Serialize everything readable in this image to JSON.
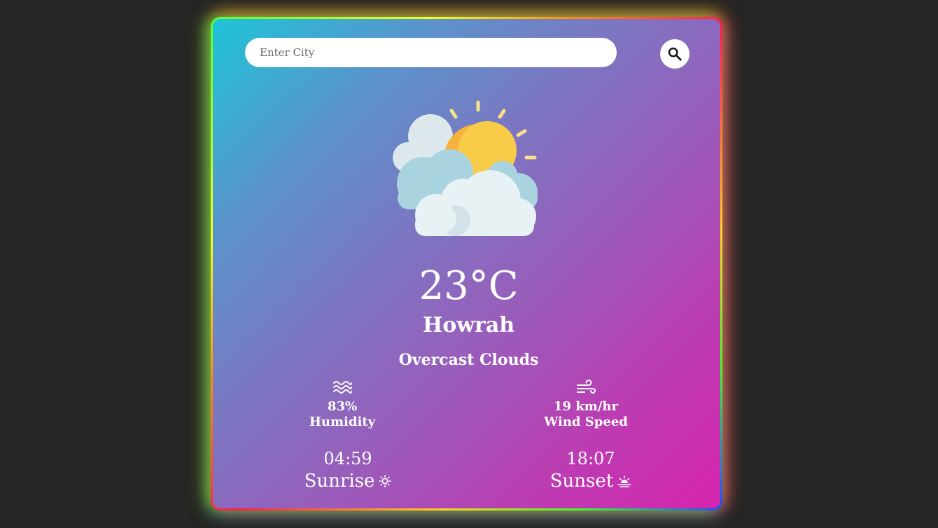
{
  "search": {
    "placeholder": "Enter City",
    "button_icon": "search-icon"
  },
  "weather": {
    "icon": "partly-cloudy-icon",
    "temperature": "23°C",
    "city": "Howrah",
    "description": "Overcast Clouds"
  },
  "humidity": {
    "icon": "humidity-waves-icon",
    "value": "83%",
    "label": "Humidity"
  },
  "wind": {
    "icon": "wind-icon",
    "value": "19 km/hr",
    "label": "Wind Speed"
  },
  "sunrise": {
    "time": "04:59",
    "label": "Sunrise",
    "icon": "sun-icon"
  },
  "sunset": {
    "time": "18:07",
    "label": "Sunset",
    "icon": "sunset-icon"
  },
  "colors": {
    "background": "#262626",
    "card_gradient_start": "#1ec4d8",
    "card_gradient_end": "#d624ae",
    "sun": "#f7b23b",
    "cloud": "#e8f1f4"
  }
}
